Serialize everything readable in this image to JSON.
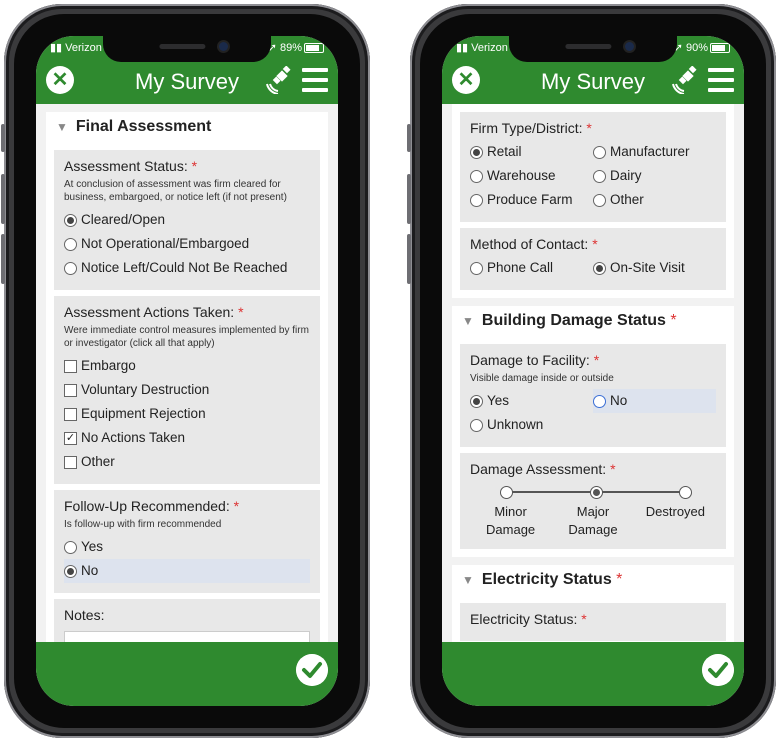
{
  "colors": {
    "brand_green": "#2f8a2f",
    "required": "#d33333",
    "card_bg": "#e8e8e8"
  },
  "left_phone": {
    "status": {
      "carrier": "Verizon",
      "battery": "89%"
    },
    "app_title": "My Survey",
    "section_title": "Final Assessment",
    "assessment_status": {
      "label": "Assessment Status:",
      "required": "*",
      "help": "At conclusion of assessment was firm cleared for business, embargoed, or notice left (if not present)",
      "options": [
        "Cleared/Open",
        "Not Operational/Embargoed",
        "Notice Left/Could Not Be Reached"
      ],
      "selected": "Cleared/Open"
    },
    "actions_taken": {
      "label": "Assessment Actions Taken:",
      "required": "*",
      "help": "Were immediate control measures implemented by firm or investigator (click all that apply)",
      "options": [
        "Embargo",
        "Voluntary Destruction",
        "Equipment Rejection",
        "No Actions Taken",
        "Other"
      ],
      "checked": "No Actions Taken"
    },
    "follow_up": {
      "label": "Follow-Up Recommended:",
      "required": "*",
      "help": "Is follow-up with firm recommended",
      "options": [
        "Yes",
        "No"
      ],
      "selected": "No"
    },
    "notes": {
      "label": "Notes:"
    }
  },
  "right_phone": {
    "status": {
      "carrier": "Verizon",
      "battery": "90%"
    },
    "app_title": "My Survey",
    "firm_type": {
      "label": "Firm Type/District:",
      "required": "*",
      "options": [
        "Retail",
        "Manufacturer",
        "Warehouse",
        "Dairy",
        "Produce Farm",
        "Other"
      ],
      "selected": "Retail"
    },
    "contact": {
      "label": "Method of Contact:",
      "required": "*",
      "options": [
        "Phone Call",
        "On-Site Visit"
      ],
      "selected": "On-Site Visit"
    },
    "building_section": {
      "title": "Building Damage Status",
      "required": "*"
    },
    "damage_facility": {
      "label": "Damage to Facility:",
      "required": "*",
      "help": "Visible damage inside or outside",
      "options": [
        "Yes",
        "No",
        "Unknown"
      ],
      "selected": "Yes"
    },
    "damage_assessment": {
      "label": "Damage Assessment:",
      "required": "*",
      "stops": [
        [
          "Minor",
          "Damage"
        ],
        [
          "Major",
          "Damage"
        ],
        [
          "Destroyed",
          ""
        ]
      ],
      "selected_index": 1
    },
    "electricity_section": {
      "title": "Electricity Status",
      "required": "*"
    },
    "electricity_q": {
      "label": "Electricity Status:",
      "required": "*"
    }
  }
}
